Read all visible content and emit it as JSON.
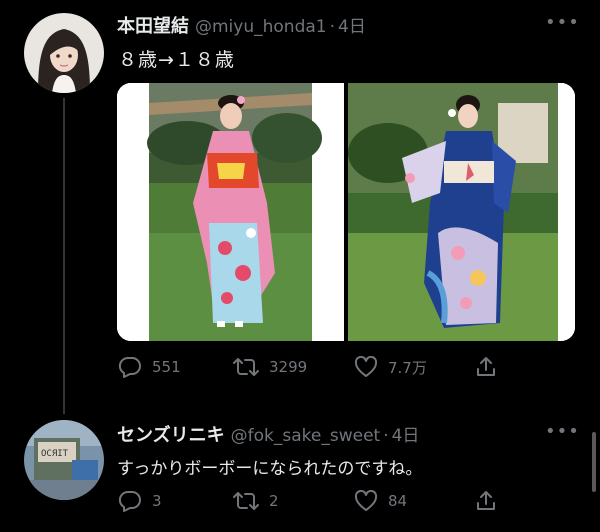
{
  "tweets": [
    {
      "name": "本田望結",
      "handle": "@miyu_honda1",
      "sep": "·",
      "time": "4日",
      "text": "８歳→１８歳",
      "replies": "551",
      "retweets": "3299",
      "likes": "7.7万"
    },
    {
      "name": "センズリニキ",
      "handle": "@fok_sake_sweet",
      "sep": "·",
      "time": "4日",
      "text": "すっかりボーボーになられたのですね。",
      "replies": "3",
      "retweets": "2",
      "likes": "84"
    }
  ],
  "media": {
    "left_image": "girl-in-pink-kimono",
    "right_image": "woman-in-blue-kimono"
  },
  "avatar2_text": "ОСЯIТ",
  "colors": {
    "background": "#000000",
    "text": "#e7e9ea",
    "secondary": "#71767b"
  }
}
